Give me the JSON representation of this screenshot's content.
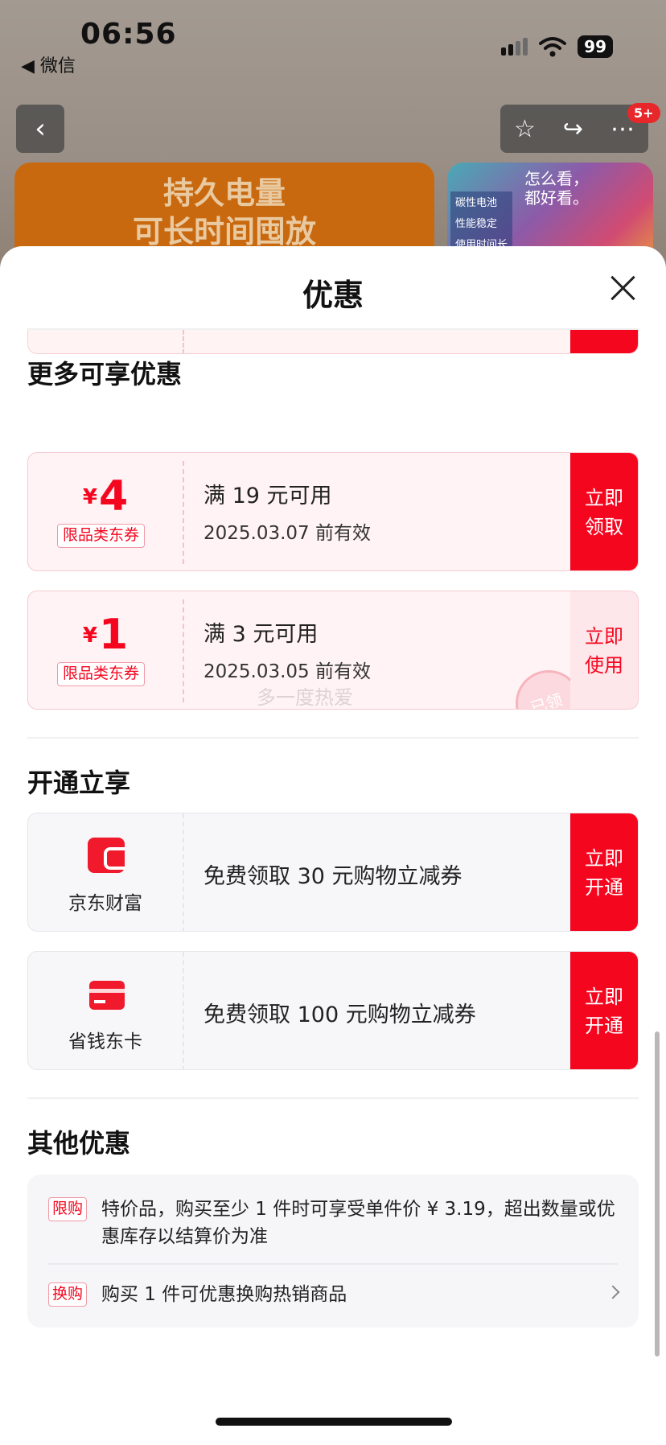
{
  "status": {
    "time": "06:56",
    "back_app": "◀ 微信",
    "battery": "99"
  },
  "nav": {
    "badge": "5+"
  },
  "background_banner": {
    "line1": "持久电量",
    "line2": "可长时间囤放",
    "side_title": "怎么看，\n都好看。",
    "side_features": [
      "碳性电池",
      "性能稳定",
      "使用时间长"
    ]
  },
  "sheet": {
    "title": "优惠"
  },
  "more_offers": {
    "title": "更多可享优惠",
    "coupons": [
      {
        "currency": "¥",
        "amount": "4",
        "tag": "限品类东券",
        "condition": "满 19 元可用",
        "valid": "2025.03.07 前有效",
        "action": "立即领取",
        "used": false
      },
      {
        "currency": "¥",
        "amount": "1",
        "tag": "限品类东券",
        "condition": "满 3 元可用",
        "valid": "2025.03.05 前有效",
        "action": "立即使用",
        "used": true,
        "stamp": "已领",
        "watermark": "多一度热爱"
      }
    ]
  },
  "open_offers": {
    "title": "开通立享",
    "items": [
      {
        "brand": "京东财富",
        "icon": "wallet-icon",
        "desc": "免费领取 30 元购物立减券",
        "action": "立即开通"
      },
      {
        "brand": "省钱东卡",
        "icon": "card-icon",
        "desc": "免费领取 100 元购物立减券",
        "action": "立即开通"
      }
    ]
  },
  "other_offers": {
    "title": "其他优惠",
    "rows": [
      {
        "tag": "限购",
        "text": "特价品，购买至少 1 件时可享受单件价 ¥ 3.19，超出数量或优惠库存以结算价为准"
      },
      {
        "tag": "换购",
        "text": "购买 1 件可优惠换购热销商品"
      }
    ]
  },
  "colors": {
    "accent_red": "#f5061f",
    "coupon_bg": "#fff3f5"
  }
}
